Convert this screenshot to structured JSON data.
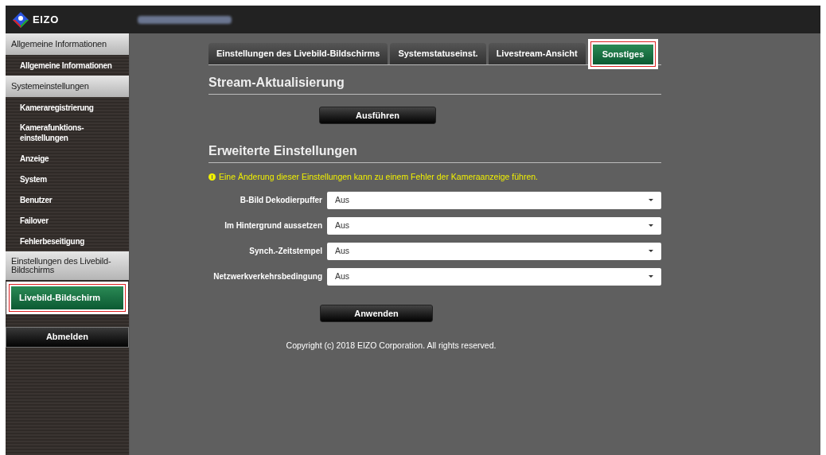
{
  "header": {
    "logo_text": "EIZO"
  },
  "sidebar": {
    "groups": [
      {
        "title": "Allgemeine Informationen",
        "items": [
          {
            "label": "Allgemeine Informationen",
            "selected": false
          }
        ]
      },
      {
        "title": "Systemeinstellungen",
        "items": [
          {
            "label": "Kameraregistrierung",
            "selected": false
          },
          {
            "label": "Kamerafunktions-\neinstellungen",
            "selected": false
          },
          {
            "label": "Anzeige",
            "selected": false
          },
          {
            "label": "System",
            "selected": false
          },
          {
            "label": "Benutzer",
            "selected": false
          },
          {
            "label": "Failover",
            "selected": false
          },
          {
            "label": "Fehlerbeseitigung",
            "selected": false
          }
        ]
      },
      {
        "title": "Einstellungen des Livebild-Bildschirms",
        "items": [
          {
            "label": "Livebild-Bildschirm",
            "selected": true
          }
        ]
      }
    ],
    "logout": "Abmelden"
  },
  "tabs": [
    {
      "label": "Einstellungen des Livebild-Bildschirms",
      "selected": false
    },
    {
      "label": "Systemstatuseinst.",
      "selected": false
    },
    {
      "label": "Livestream-Ansicht",
      "selected": false
    },
    {
      "label": "Sonstiges",
      "selected": true
    }
  ],
  "stream_section": {
    "title": "Stream-Aktualisierung",
    "button": "Ausführen"
  },
  "advanced_section": {
    "title": "Erweiterte Einstellungen",
    "warning": "Eine Änderung dieser Einstellungen kann zu einem Fehler der Kameraanzeige führen.",
    "fields": [
      {
        "label": "B-Bild Dekodierpuffer",
        "value": "Aus"
      },
      {
        "label": "Im Hintergrund aussetzen",
        "value": "Aus"
      },
      {
        "label": "Synch.-Zeitstempel",
        "value": "Aus"
      },
      {
        "label": "Netzwerkverkehrsbedingung",
        "value": "Aus"
      }
    ],
    "button": "Anwenden"
  },
  "footer": "Copyright (c) 2018 EIZO Corporation. All rights reserved."
}
